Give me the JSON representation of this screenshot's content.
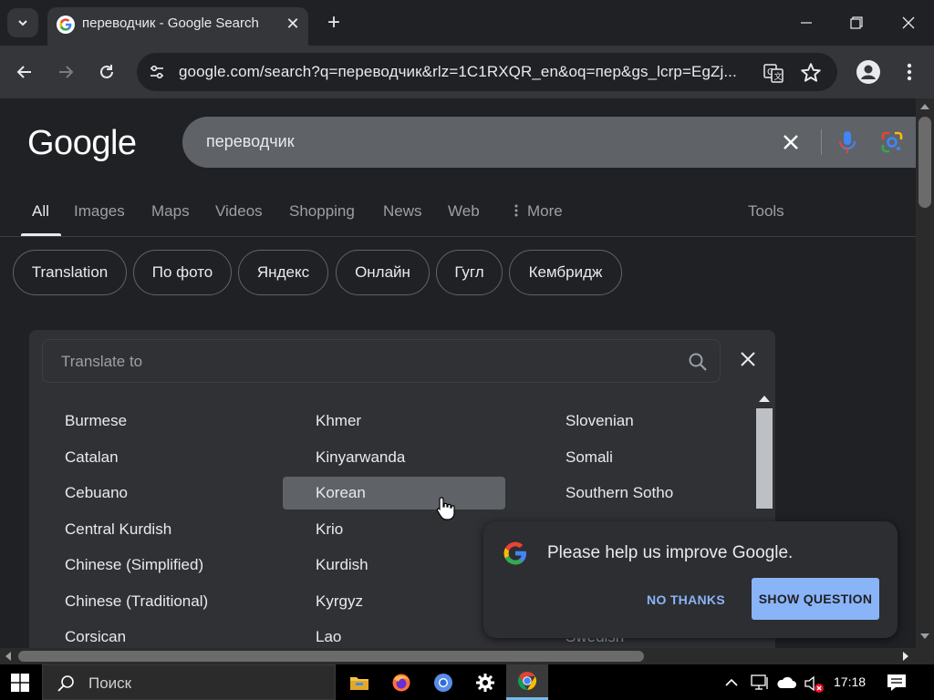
{
  "tab": {
    "title": "переводчик - Google Search"
  },
  "address": {
    "url": "google.com/search?q=переводчик&rlz=1C1RXQR_en&oq=пер&gs_lcrp=EgZj..."
  },
  "google": {
    "logo": "Google"
  },
  "search": {
    "query": "переводчик"
  },
  "nav": {
    "tabs": [
      "All",
      "Images",
      "Maps",
      "Videos",
      "Shopping",
      "News",
      "Web",
      "More",
      "Tools"
    ],
    "active": "All"
  },
  "chips": [
    "Translation",
    "По фото",
    "Яндекс",
    "Онлайн",
    "Гугл",
    "Кембридж"
  ],
  "translate": {
    "placeholder": "Translate to",
    "columns": [
      [
        "Burmese",
        "Catalan",
        "Cebuano",
        "Central Kurdish",
        "Chinese (Simplified)",
        "Chinese (Traditional)",
        "Corsican"
      ],
      [
        "Khmer",
        "Kinyarwanda",
        "Korean",
        "Krio",
        "Kurdish",
        "Kyrgyz",
        "Lao"
      ],
      [
        "Slovenian",
        "Somali",
        "Southern Sotho",
        "",
        "",
        "",
        "Swedish"
      ]
    ],
    "hovered": "Korean"
  },
  "feedback": {
    "message": "Please help us improve Google.",
    "no_thanks": "NO THANKS",
    "show_question": "SHOW QUESTION"
  },
  "taskbar": {
    "search_placeholder": "Поиск",
    "clock": "17:18",
    "apps": [
      "file-explorer",
      "firefox",
      "chromium",
      "settings",
      "chrome"
    ]
  },
  "colors": {
    "background": "#202124",
    "toolbar": "#35363a",
    "search_box": "#5f6368",
    "accent_blue": "#8ab4f8",
    "text": "#e8eaed",
    "text_muted": "#9aa0a6"
  }
}
